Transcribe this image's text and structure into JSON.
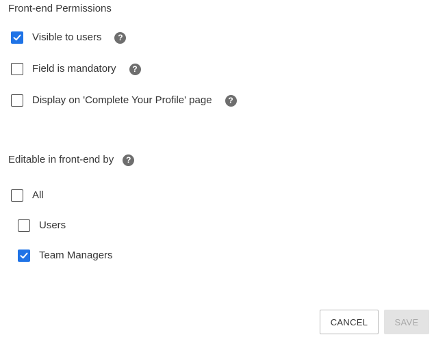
{
  "frontend_permissions": {
    "title": "Front-end Permissions",
    "options": [
      {
        "label": "Visible to users",
        "checked": true,
        "help_icon": "question-circle-icon"
      },
      {
        "label": "Field is mandatory",
        "checked": false,
        "help_icon": "question-circle-icon"
      },
      {
        "label": "Display on 'Complete Your Profile' page",
        "checked": false,
        "help_icon": "question-circle-icon"
      }
    ]
  },
  "editable_by": {
    "title": "Editable in front-end by",
    "help_icon": "question-circle-icon",
    "options": [
      {
        "label": "All",
        "checked": false
      },
      {
        "label": "Users",
        "checked": false
      },
      {
        "label": "Team Managers",
        "checked": true
      }
    ]
  },
  "help_glyph": "?",
  "actions": {
    "cancel_label": "CANCEL",
    "save_label": "SAVE",
    "save_enabled": false
  },
  "colors": {
    "accent": "#1f73e6",
    "help_icon": "#6e6e6e",
    "disabled_button": "#e3e3e3"
  }
}
